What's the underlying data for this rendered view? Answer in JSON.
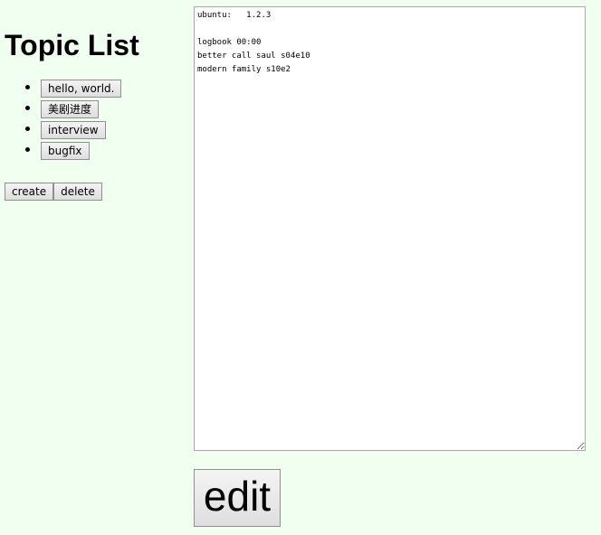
{
  "sidebar": {
    "title": "Topic List",
    "topics": [
      {
        "label": "hello, world."
      },
      {
        "label": "美剧进度"
      },
      {
        "label": "interview"
      },
      {
        "label": "bugfix"
      }
    ],
    "create_label": "create",
    "delete_label": "delete"
  },
  "editor": {
    "content": "ubuntu:   1.2.3\n    \nlogbook 00:00\nbetter call saul s04e10\nmodern family s10e2"
  },
  "edit_label": "edit"
}
